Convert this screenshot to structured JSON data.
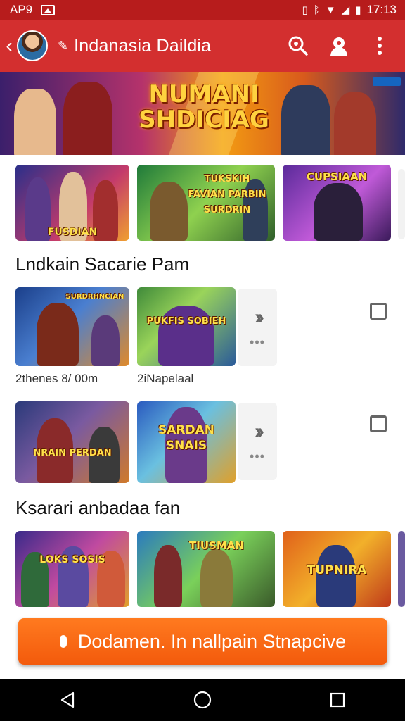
{
  "status_bar": {
    "carrier": "AP9",
    "time": "17:13"
  },
  "app_bar": {
    "title": "Indanasia Daildia"
  },
  "hero": {
    "title": "NUMANI SHDICIAG"
  },
  "row1": [
    {
      "caption": "FUSDIAN"
    },
    {
      "caption": "TUKSKIH FAVIAN PARBIN SURDRIN"
    },
    {
      "caption": "CUPSIAAN"
    }
  ],
  "section1": {
    "title": "Lndkain Sacarie Pam"
  },
  "row2": {
    "tiles": [
      {
        "caption": "SURDRHNCIAN"
      },
      {
        "caption": "PUKFIS SOBIEH"
      }
    ],
    "meta_left": "2thenes 8/ 00m",
    "meta_right": "2iNapelaal"
  },
  "row3": {
    "tiles": [
      {
        "caption": "NRAIN PERDAN"
      },
      {
        "caption": "SARDAN SNAIS"
      }
    ]
  },
  "section2": {
    "title": "Ksarari anbadaa fan"
  },
  "row4": [
    {
      "caption": "LOKS SOSIS"
    },
    {
      "caption": "TIUSMAN"
    },
    {
      "caption": "TUPNIRA"
    }
  ],
  "cta": {
    "label": "Dodamen. In nallpain Stnapcive"
  },
  "colors": {
    "app_bar": "#d32f2f",
    "status_bar": "#b71c1c",
    "cta": "#f35a0c"
  }
}
